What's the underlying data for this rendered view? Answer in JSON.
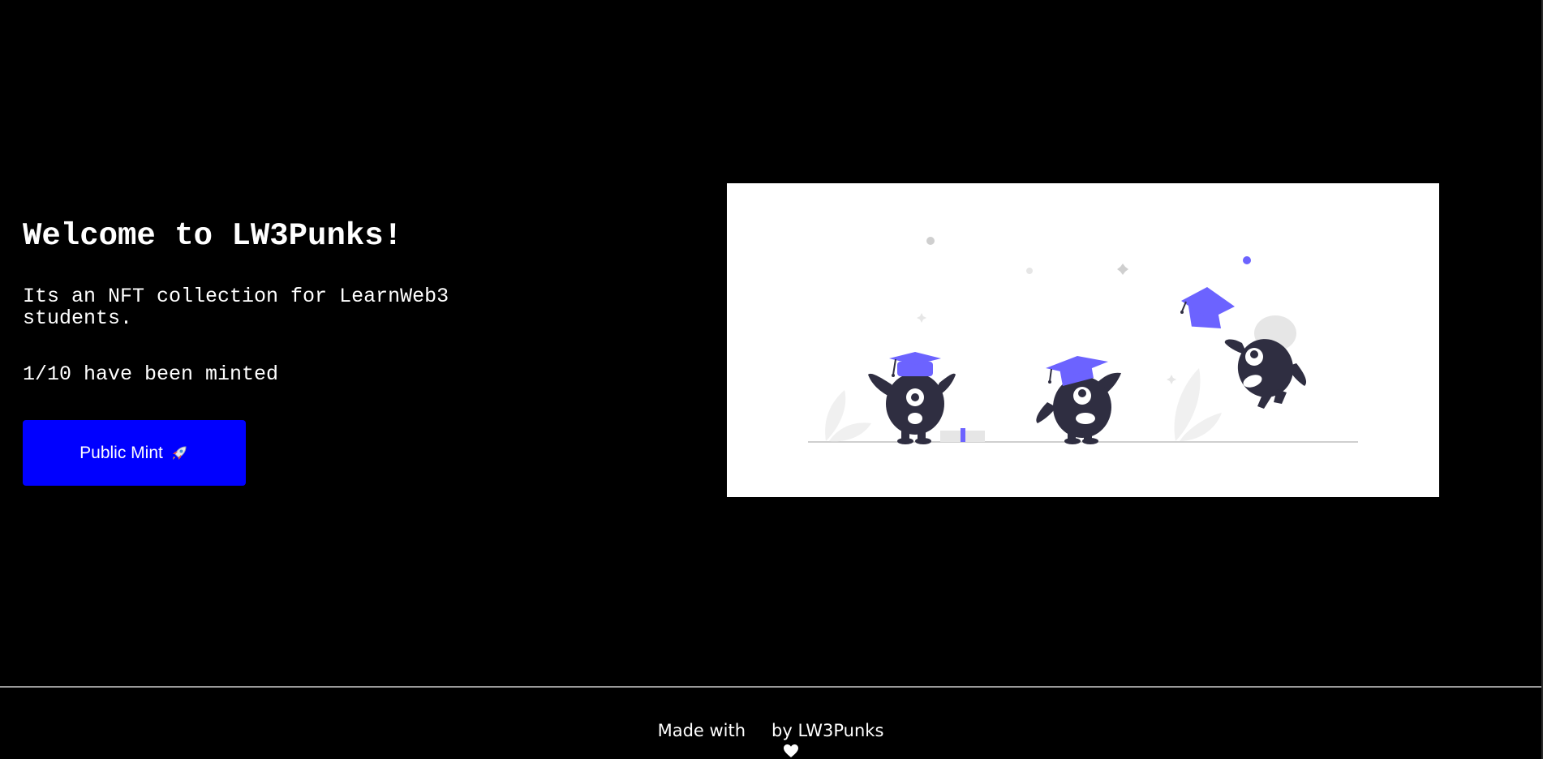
{
  "hero": {
    "title": "Welcome to LW3Punks!",
    "description": "Its an NFT collection for LearnWeb3 students.",
    "mint_status": "1/10 have been minted",
    "mint_button_label": "Public Mint",
    "mint_button_icon": "rocket-icon"
  },
  "illustration": {
    "icon": "graduation-creatures-illustration"
  },
  "footer": {
    "prefix": "Made with",
    "icon": "heart-icon",
    "suffix": "by LW3Punks"
  },
  "colors": {
    "background": "#000000",
    "button": "#0000ff",
    "accent": "#6c63ff",
    "creature": "#2f2e41"
  }
}
